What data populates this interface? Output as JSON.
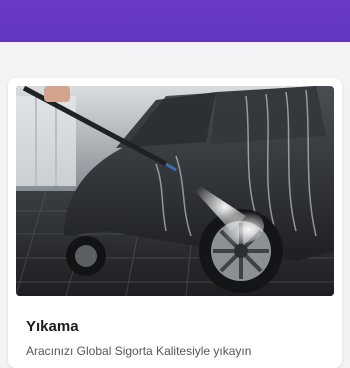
{
  "header": {
    "bar_color": "#6236c0"
  },
  "service_card": {
    "image_icon": "car-wash-photo",
    "title": "Yıkama",
    "description": "Aracınızı Global Sigorta Kalitesiyle yıkayın"
  }
}
